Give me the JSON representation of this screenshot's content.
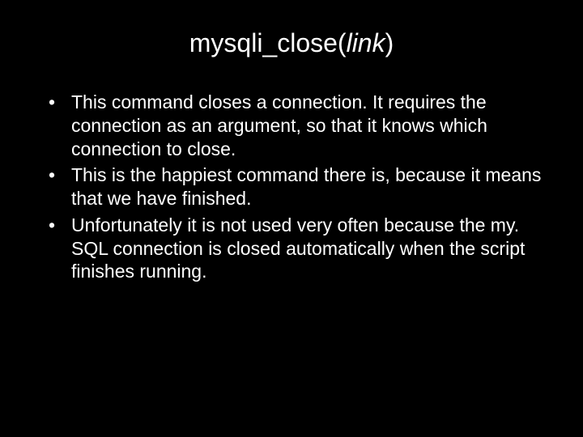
{
  "slide": {
    "title_prefix": "mysqli_close(",
    "title_italic": "link",
    "title_suffix": ")",
    "bullets": [
      "This command closes a connection. It requires the connection as an argument, so that it knows which connection to close.",
      "This is the happiest command there is, because it means that we have finished.",
      "Unfortunately it is not used very often because the my. SQL connection is closed automatically when the script finishes running."
    ]
  }
}
